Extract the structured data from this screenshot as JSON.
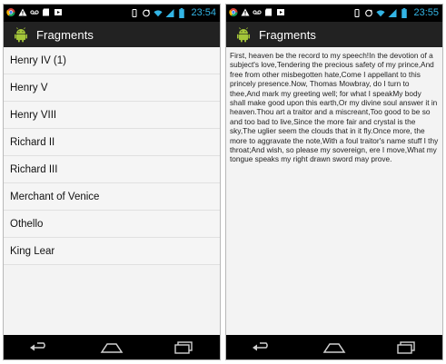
{
  "left_screen": {
    "status_time": "23:54",
    "app_title": "Fragments",
    "plays": [
      "Henry IV (1)",
      "Henry V",
      "Henry VIII",
      "Richard II",
      "Richard III",
      "Merchant of Venice",
      "Othello",
      "King Lear"
    ]
  },
  "right_screen": {
    "status_time": "23:55",
    "app_title": "Fragments",
    "speech": "First, heaven be the record to my speech!In the devotion of a subject's love,Tendering the precious safety of my prince,And free from other misbegotten hate,Come I appellant to this princely presence.Now, Thomas Mowbray, do I turn to thee,And mark my greeting well; for what I speakMy body shall make good upon this earth,Or my divine soul answer it in heaven.Thou art a traitor and a miscreant,Too good to be so and too bad to live,Since the more fair and crystal is the sky,The uglier seem the clouds that in it fly.Once more, the more to aggravate the note,With a foul traitor's name stuff I thy throat;And wish, so please my sovereign, ere I move,What my tongue speaks my right drawn sword may prove."
  },
  "colors": {
    "status_accent": "#33b5e5",
    "action_bar": "#222222",
    "android_green": "#a4c639"
  },
  "icons": [
    "chrome-icon",
    "alert-icon",
    "voicemail-icon",
    "sd-card-icon",
    "play-store-icon",
    "vibrate-icon",
    "sync-icon",
    "wifi-icon",
    "signal-icon",
    "battery-icon",
    "back-icon",
    "home-icon",
    "recent-apps-icon"
  ]
}
